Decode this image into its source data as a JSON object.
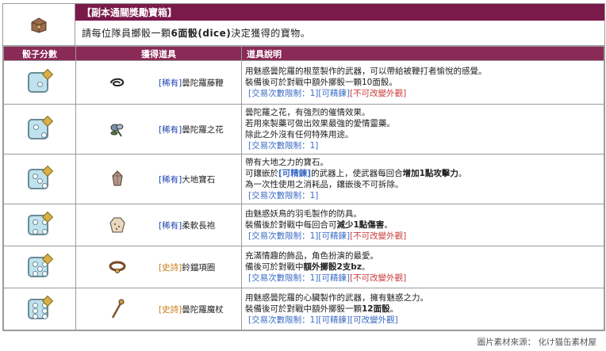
{
  "header": {
    "title": "【副本通關獎勵寶箱】",
    "desc_pre": "請每位隊員擲骰一顆 ",
    "desc_bold": "6面骰(dice)",
    "desc_post": " 決定獲得的寶物。",
    "icon": "treasure-chest-icon"
  },
  "columns": [
    "骰子分數",
    "獲得道具",
    "道具說明"
  ],
  "rows": [
    {
      "score": 1,
      "item_icon": "whip-icon",
      "tag": "[稀有]",
      "tag_type": "rare",
      "name": "曇陀羅藤鞭",
      "lines": [
        {
          "t": "用魅惑曇陀羅的根莖製作的武器，可以帶給被鞭打者愉悅的感覺。"
        },
        {
          "t": "裝備後可於對戰中額外擲骰一顆10面骰。"
        },
        {
          "note": "[交易次數限制：1][可精鍊]",
          "red": "[不可改變外觀]"
        }
      ]
    },
    {
      "score": 2,
      "item_icon": "flower-icon",
      "tag": "[稀有]",
      "tag_type": "rare",
      "name": "曇陀羅之花",
      "lines": [
        {
          "t": "曇陀羅之花，有強烈的催情效果。"
        },
        {
          "t": "若用來製藥可做出效果最強的愛情靈藥。"
        },
        {
          "t": "除此之外沒有任何特殊用途。"
        },
        {
          "note": "[交易次數限制：1]"
        }
      ]
    },
    {
      "score": 3,
      "item_icon": "gem-icon",
      "tag": "[稀有]",
      "tag_type": "rare",
      "name": "大地寶石",
      "lines": [
        {
          "t": "帶有大地之力的寶石。"
        },
        {
          "pre": "可鑲嵌於",
          "mid": "[可精鍊]",
          "post": "的武器上，使武器每回合",
          "bold": "增加1點攻擊力",
          "end": "。"
        },
        {
          "t": "為一次性使用之消耗品，鑲嵌後不可拆除。"
        },
        {
          "note": "[交易次數限制：1]"
        }
      ]
    },
    {
      "score": 4,
      "item_icon": "robe-icon",
      "tag": "[稀有]",
      "tag_type": "rare",
      "name": "柔軟長袍",
      "lines": [
        {
          "t": "由魅惑妖鳥的羽毛製作的防具。"
        },
        {
          "pre": "裝備後於對戰中每回合可",
          "bold": "減少1點傷害",
          "end": "。"
        },
        {
          "note": "[交易次數限制：1][可精鍊]",
          "red": "[不可改變外觀]"
        }
      ]
    },
    {
      "score": 5,
      "item_icon": "collar-icon",
      "tag": "[史詩]",
      "tag_type": "epic",
      "name": "鈴鐺項圈",
      "lines": [
        {
          "t": "充滿情趣的飾品，角色扮演的最愛。"
        },
        {
          "pre": "備後可於對戰中",
          "bold": "額外擲骰2支bz",
          "end": "。"
        },
        {
          "note": "[交易次數限制：1][可精鍊]",
          "red": "[不可改變外觀]"
        }
      ]
    },
    {
      "score": 6,
      "item_icon": "staff-icon",
      "tag": "[史詩]",
      "tag_type": "epic",
      "name": "曇陀羅魔杖",
      "lines": [
        {
          "t": "用魅惑曇陀羅的心臟製作的武器，擁有魅惑之力。"
        },
        {
          "pre": "裝備後可於對戰中額外擲骰一顆",
          "bold": "12面骰",
          "end": "。"
        },
        {
          "note": "[交易次數限制：1][可精鍊][可改變外觀]"
        }
      ]
    }
  ],
  "credit": "圖片素材來源： 化け猫缶素材屋",
  "colors": {
    "title_bg": "#7a1a4a",
    "header_bg": "#8a2a56",
    "rare": "#1a3fb0",
    "epic": "#c87a12",
    "note": "#3a6bc4"
  }
}
